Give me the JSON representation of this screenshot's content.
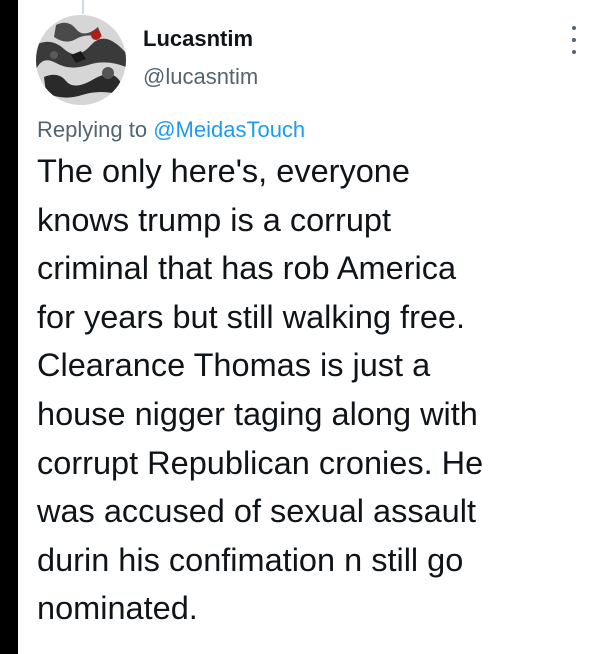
{
  "tweet": {
    "display_name": "Lucasntim",
    "handle": "@lucasntim",
    "reply_prefix": "Replying to",
    "reply_mention": "@MeidasTouch",
    "body_lines": [
      "The only here's, everyone",
      "knows trump is a corrupt",
      "criminal that has rob America",
      "for years but still walking free.",
      "Clearance Thomas is just a",
      "house nigger taging along with",
      "corrupt Republican cronies. He",
      "was accused of sexual assault",
      "durin his confimation n still go",
      "nominated."
    ]
  },
  "icons": {
    "more": "more-vertical-icon",
    "avatar": "profile-avatar"
  },
  "colors": {
    "text": "#0f1419",
    "secondary": "#536471",
    "link": "#1d9bf0",
    "left_bar": "#000000"
  }
}
